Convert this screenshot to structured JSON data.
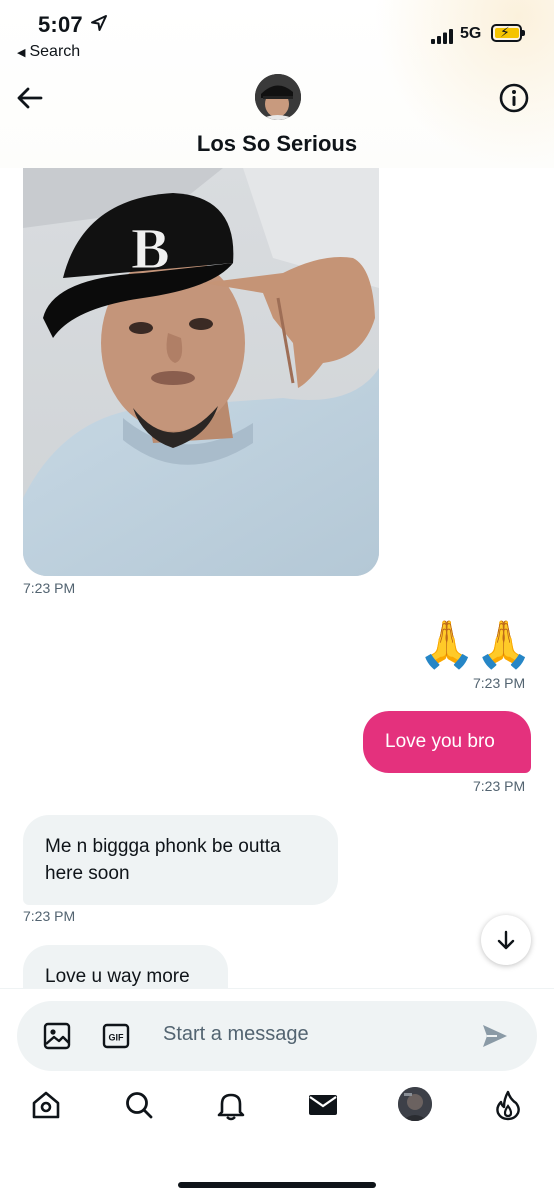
{
  "status_bar": {
    "time": "5:07",
    "back_app": "Search",
    "network": "5G"
  },
  "header": {
    "title": "Los So Serious"
  },
  "messages": [
    {
      "type": "image",
      "side": "in",
      "time": "7:23 PM",
      "photo_text": "B"
    },
    {
      "type": "emoji",
      "side": "out",
      "text": "🙏🙏",
      "time": "7:23 PM"
    },
    {
      "type": "text",
      "side": "out",
      "text": "Love you bro",
      "time": "7:23 PM"
    },
    {
      "type": "text",
      "side": "in",
      "text": "Me n biggga phonk be outta here soon",
      "time": "7:23 PM"
    },
    {
      "type": "text",
      "side": "in",
      "text": "Love u way more"
    }
  ],
  "composer": {
    "placeholder": "Start a message"
  },
  "bottom_nav": [
    "home",
    "search",
    "notifications",
    "messages",
    "profile",
    "spaces"
  ],
  "colors": {
    "outgoing_bubble": "#e4317d",
    "incoming_bubble": "#eff3f4",
    "secondary_text": "#536471",
    "battery_fill": "#f5c400"
  }
}
